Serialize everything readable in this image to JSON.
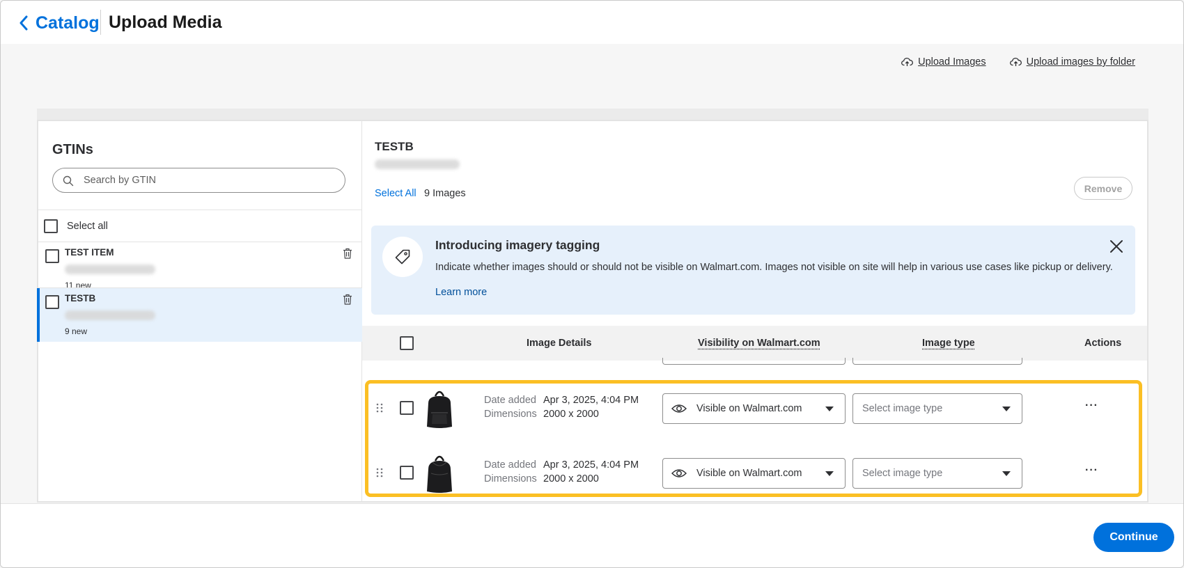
{
  "header": {
    "back_label": "Catalog",
    "title": "Upload Media"
  },
  "toolbar": {
    "upload_images": "Upload Images",
    "upload_by_folder": "Upload images by folder"
  },
  "gtins": {
    "title": "GTINs",
    "search_placeholder": "Search by GTIN",
    "select_all": "Select all",
    "items": [
      {
        "name": "TEST ITEM",
        "count": "11 new",
        "active": false
      },
      {
        "name": "TESTB",
        "count": "9 new",
        "active": true
      }
    ]
  },
  "detail": {
    "title": "TESTB",
    "select_all": "Select All",
    "image_count": "9 Images",
    "remove": "Remove"
  },
  "banner": {
    "title": "Introducing imagery tagging",
    "text": "Indicate whether images should or should not be visible on Walmart.com. Images not visible on site will help in various use cases like pickup or delivery.",
    "learn_more": "Learn more"
  },
  "table": {
    "headers": {
      "details": "Image Details",
      "visibility": "Visibility on Walmart.com",
      "type": "Image type",
      "actions": "Actions"
    },
    "rows": [
      {
        "date_label": "Date added",
        "date": "Apr 3, 2025, 4:04 PM",
        "dim_label": "Dimensions",
        "dimensions": "2000 x 2000",
        "visibility": "Visible on Walmart.com",
        "type_placeholder": "Select image type",
        "more": "···"
      },
      {
        "date_label": "Date added",
        "date": "Apr 3, 2025, 4:04 PM",
        "dim_label": "Dimensions",
        "dimensions": "2000 x 2000",
        "visibility": "Visible on Walmart.com",
        "type_placeholder": "Select image type",
        "more": "···"
      }
    ]
  },
  "footer": {
    "continue": "Continue"
  },
  "colors": {
    "accent": "#0071dc",
    "highlight": "#fbbf24",
    "banner_bg": "#e6f0fb",
    "active_row": "#e6f1fc"
  }
}
